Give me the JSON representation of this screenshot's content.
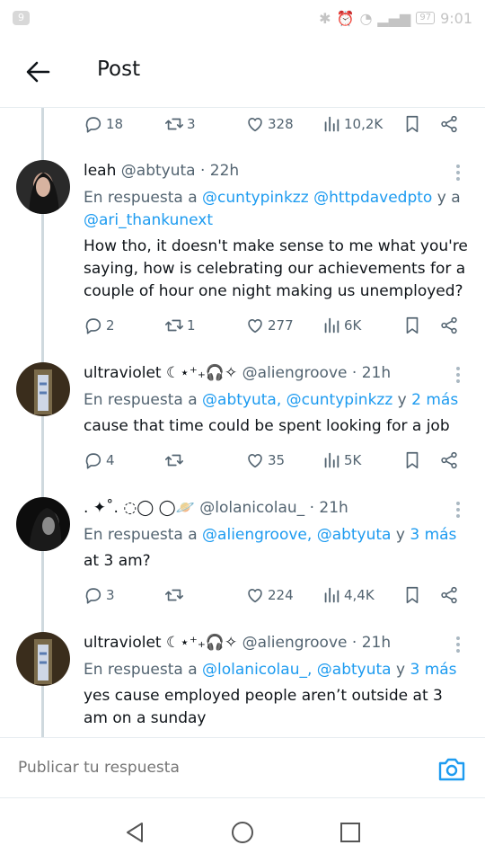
{
  "status_bar": {
    "notification_count": "9",
    "battery": "97",
    "time": "9:01"
  },
  "header": {
    "title": "Post"
  },
  "parent_actions": {
    "replies": "18",
    "retweets": "3",
    "likes": "328",
    "views": "10,2K"
  },
  "tweets": [
    {
      "name": "leah",
      "handle": "@abtyuta",
      "time": "· 22h",
      "reply_prefix": "En respuesta a",
      "mentions": [
        "@cuntypinkzz",
        "@httpdavedpto"
      ],
      "joiner": "y a",
      "mention_last": "@ari_thankunext",
      "body": "How tho, it doesn't make sense to me what you're saying, how is celebrating our achievements for a couple of hour one night making us unemployed?",
      "replies": "2",
      "retweets": "1",
      "likes": "277",
      "views": "6K"
    },
    {
      "name": "ultraviolet ☾⋆⁺₊🎧✧",
      "handle": "@aliengroove",
      "time": "· 21h",
      "reply_prefix": "En respuesta a",
      "mentions": [
        "@abtyuta,",
        "@cuntypinkzz"
      ],
      "joiner": "y",
      "more": "2 más",
      "body": "cause that time could be spent looking for a job",
      "replies": "4",
      "retweets": "",
      "likes": "35",
      "views": "5K"
    },
    {
      "name": ". ✦˚. ◌◯ ◯🪐",
      "handle": "@lolanicolau_",
      "time": "· 21h",
      "reply_prefix": "En respuesta a",
      "mentions": [
        "@aliengroove,",
        "@abtyuta"
      ],
      "joiner": "y",
      "more": "3 más",
      "body": "at 3 am?",
      "replies": "3",
      "retweets": "",
      "likes": "224",
      "views": "4,4K"
    },
    {
      "name": "ultraviolet ☾⋆⁺₊🎧✧",
      "handle": "@aliengroove",
      "time": "· 21h",
      "reply_prefix": "En respuesta a",
      "mentions": [
        "@lolanicolau_,",
        "@abtyuta"
      ],
      "joiner": "y",
      "more": "3 más",
      "body": "yes cause employed people aren’t outside at 3 am on a sunday"
    }
  ],
  "composer": {
    "placeholder": "Publicar tu respuesta"
  },
  "colors": {
    "accent": "#1d9bf0",
    "muted": "#536471",
    "text": "#0f1419"
  }
}
